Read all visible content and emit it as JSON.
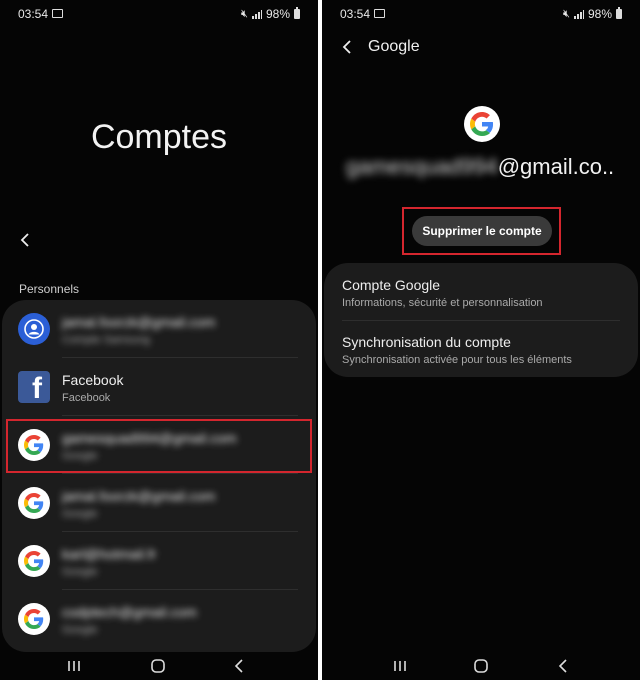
{
  "left": {
    "status": {
      "time": "03:54",
      "battery": "98%"
    },
    "title": "Comptes",
    "section_label": "Personnels",
    "accounts": [
      {
        "title": "jamal.foorzk@gmail.com",
        "subtitle": "Compte Samsung",
        "icon": "samsung-account-icon",
        "blurred": true
      },
      {
        "title": "Facebook",
        "subtitle": "Facebook",
        "icon": "facebook-icon",
        "blurred": false
      },
      {
        "title": "gamesquad994@gmail.com",
        "subtitle": "Google",
        "icon": "google-icon",
        "blurred": true
      },
      {
        "title": "jamal.foorzk@gmail.com",
        "subtitle": "Google",
        "icon": "google-icon",
        "blurred": true
      },
      {
        "title": "karl@hotmail.fr",
        "subtitle": "Google",
        "icon": "google-icon",
        "blurred": true
      },
      {
        "title": "codptech@gmail.com",
        "subtitle": "Google",
        "icon": "google-icon",
        "blurred": true
      }
    ]
  },
  "right": {
    "status": {
      "time": "03:54",
      "battery": "98%"
    },
    "header_title": "Google",
    "email_hidden": "gamesquad994",
    "email_visible": "@gmail.co..",
    "remove_button": "Supprimer le compte",
    "options": [
      {
        "title": "Compte Google",
        "subtitle": "Informations, sécurité et personnalisation"
      },
      {
        "title": "Synchronisation du compte",
        "subtitle": "Synchronisation activée pour tous les éléments"
      }
    ]
  },
  "colors": {
    "highlight": "#d4262e",
    "background": "#050505",
    "card": "#1c1c1c"
  }
}
